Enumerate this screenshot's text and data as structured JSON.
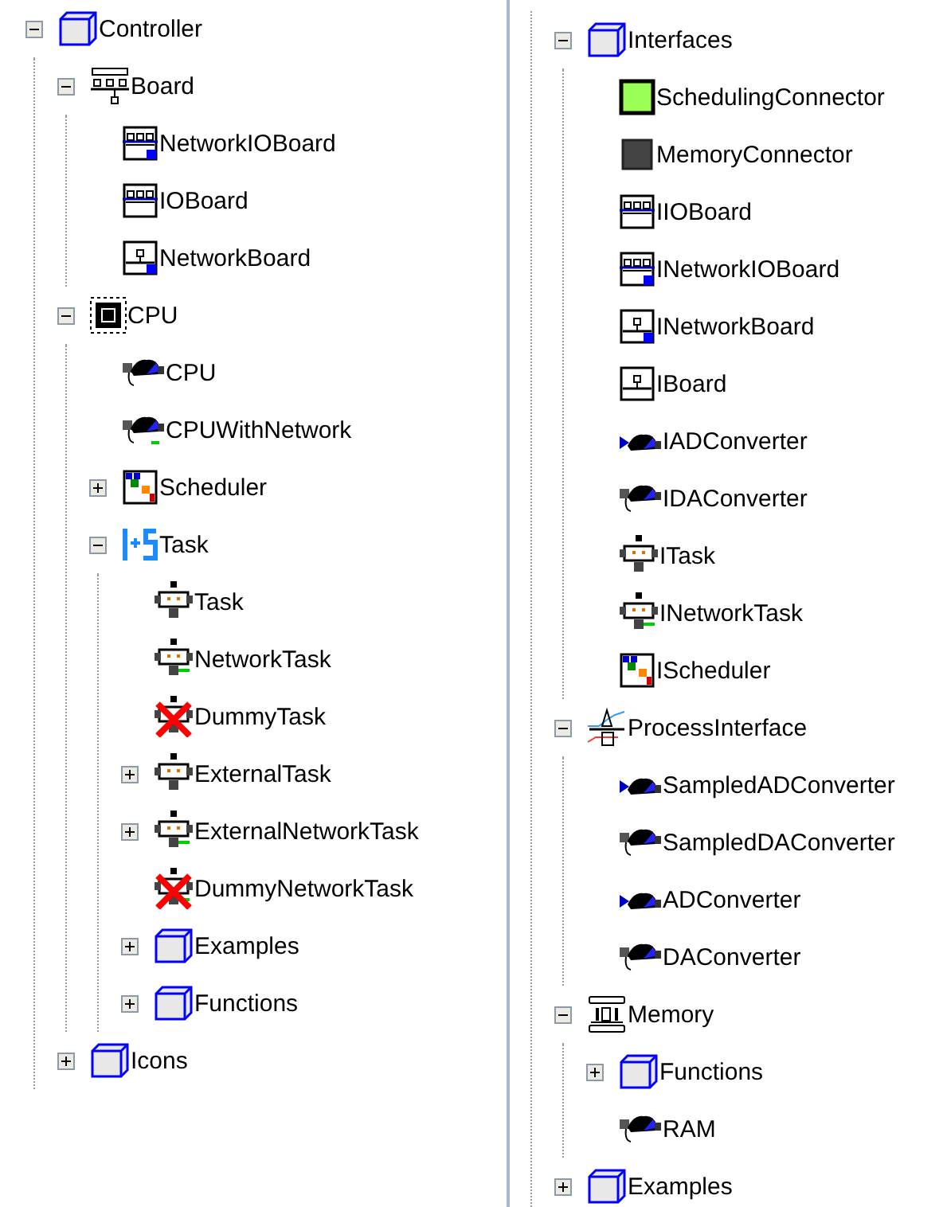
{
  "left_tree": [
    {
      "label": "Controller",
      "kind": "folder",
      "expanded": true,
      "children": [
        {
          "label": "Board",
          "kind": "board-group",
          "expanded": true,
          "children": [
            {
              "label": "NetworkIOBoard",
              "kind": "network-io-board"
            },
            {
              "label": "IOBoard",
              "kind": "io-board"
            },
            {
              "label": "NetworkBoard",
              "kind": "network-board"
            }
          ]
        },
        {
          "label": "CPU",
          "kind": "chip",
          "expanded": true,
          "children": [
            {
              "label": "CPU",
              "kind": "processor"
            },
            {
              "label": "CPUWithNetwork",
              "kind": "processor-network"
            },
            {
              "label": "Scheduler",
              "kind": "scheduler",
              "expanded": false
            },
            {
              "label": "Task",
              "kind": "task-group",
              "expanded": true,
              "children": [
                {
                  "label": "Task",
                  "kind": "task"
                },
                {
                  "label": "NetworkTask",
                  "kind": "network-task"
                },
                {
                  "label": "DummyTask",
                  "kind": "dummy-task"
                },
                {
                  "label": "ExternalTask",
                  "kind": "task",
                  "expanded": false
                },
                {
                  "label": "ExternalNetworkTask",
                  "kind": "network-task",
                  "expanded": false
                },
                {
                  "label": "DummyNetworkTask",
                  "kind": "dummy-network-task"
                },
                {
                  "label": "Examples",
                  "kind": "folder",
                  "expanded": false
                },
                {
                  "label": "Functions",
                  "kind": "folder",
                  "expanded": false
                }
              ]
            }
          ]
        },
        {
          "label": "Icons",
          "kind": "folder",
          "expanded": false
        }
      ]
    }
  ],
  "right_tree": [
    {
      "label": "Interfaces",
      "kind": "folder",
      "expanded": true,
      "children": [
        {
          "label": "SchedulingConnector",
          "kind": "scheduling-connector"
        },
        {
          "label": "MemoryConnector",
          "kind": "memory-connector"
        },
        {
          "label": "IIOBoard",
          "kind": "io-board"
        },
        {
          "label": "INetworkIOBoard",
          "kind": "network-io-board"
        },
        {
          "label": "INetworkBoard",
          "kind": "network-board"
        },
        {
          "label": "IBoard",
          "kind": "board"
        },
        {
          "label": "IADConverter",
          "kind": "ad-converter"
        },
        {
          "label": "IDAConverter",
          "kind": "da-converter"
        },
        {
          "label": "ITask",
          "kind": "task"
        },
        {
          "label": "INetworkTask",
          "kind": "network-task"
        },
        {
          "label": "IScheduler",
          "kind": "scheduler-interface"
        }
      ]
    },
    {
      "label": "ProcessInterface",
      "kind": "process-interface",
      "expanded": true,
      "children": [
        {
          "label": "SampledADConverter",
          "kind": "ad-converter"
        },
        {
          "label": "SampledDAConverter",
          "kind": "da-converter"
        },
        {
          "label": "ADConverter",
          "kind": "ad-converter"
        },
        {
          "label": "DAConverter",
          "kind": "da-converter"
        }
      ]
    },
    {
      "label": "Memory",
      "kind": "memory",
      "expanded": true,
      "children": [
        {
          "label": "Functions",
          "kind": "folder",
          "expanded": false
        },
        {
          "label": "RAM",
          "kind": "processor"
        }
      ]
    },
    {
      "label": "Examples",
      "kind": "folder",
      "expanded": false
    }
  ]
}
